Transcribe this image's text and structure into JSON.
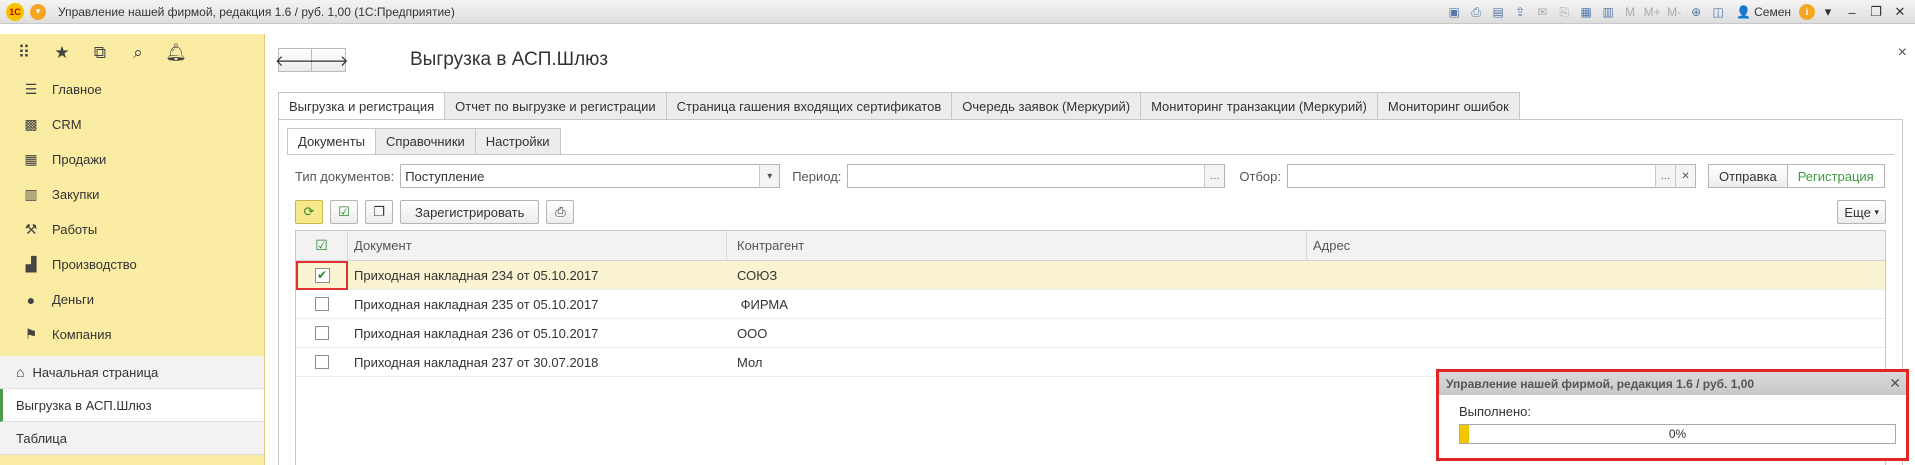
{
  "titlebar": {
    "title": "Управление нашей фирмой, редакция 1.6 / руб. 1,00  (1С:Предприятие)",
    "user": "Семен",
    "logo": "1С"
  },
  "sidebar": {
    "items": [
      {
        "label": "Главное",
        "icon": "list-icon"
      },
      {
        "label": "CRM",
        "icon": "contacts-icon"
      },
      {
        "label": "Продажи",
        "icon": "sales-icon"
      },
      {
        "label": "Закупки",
        "icon": "cart-icon"
      },
      {
        "label": "Работы",
        "icon": "tools-icon"
      },
      {
        "label": "Производство",
        "icon": "factory-icon"
      },
      {
        "label": "Деньги",
        "icon": "money-icon"
      },
      {
        "label": "Компания",
        "icon": "flag-icon"
      }
    ],
    "open_windows": [
      {
        "label": "Начальная страница"
      },
      {
        "label": "Выгрузка в АСП.Шлюз"
      },
      {
        "label": "Таблица"
      }
    ]
  },
  "main": {
    "title": "Выгрузка в АСП.Шлюз",
    "tabs": [
      {
        "label": "Выгрузка и регистрация"
      },
      {
        "label": "Отчет по выгрузке и регистрации"
      },
      {
        "label": "Страница гашения входящих сертификатов"
      },
      {
        "label": "Очередь заявок (Меркурий)"
      },
      {
        "label": "Мониторинг транзакции (Меркурий)"
      },
      {
        "label": "Мониторинг ошибок"
      }
    ],
    "subtabs": [
      {
        "label": "Документы"
      },
      {
        "label": "Справочники"
      },
      {
        "label": "Настройки"
      }
    ],
    "filters": {
      "doc_type_label": "Тип документов:",
      "doc_type_value": "Поступление",
      "period_label": "Период:",
      "period_value": "",
      "filter_label": "Отбор:",
      "filter_value": "",
      "mode_send": "Отправка",
      "mode_register": "Регистрация"
    },
    "toolbar": {
      "register_label": "Зарегистрировать",
      "more_label": "Еще"
    },
    "table": {
      "columns": [
        "Документ",
        "Контрагент",
        "Адрес"
      ],
      "rows": [
        {
          "checked": true,
          "document": "Приходная накладная 234 от 05.10.2017",
          "counterparty": "СОЮЗ",
          "address": ""
        },
        {
          "checked": false,
          "document": "Приходная накладная 235 от 05.10.2017",
          "counterparty": " ФИРМА",
          "address": ""
        },
        {
          "checked": false,
          "document": "Приходная накладная 236 от 05.10.2017",
          "counterparty": "ООО",
          "address": ""
        },
        {
          "checked": false,
          "document": "Приходная накладная 237 от 30.07.2018",
          "counterparty": "Мол",
          "address": ""
        }
      ]
    }
  },
  "progress_popup": {
    "title": "Управление нашей фирмой, редакция 1.6 / руб. 1,00",
    "label": "Выполнено:",
    "percent_text": "0%",
    "progress": 0.005
  },
  "colors": {
    "sidebar_bg": "#fbeca3",
    "accent_green": "#3f9a3f",
    "highlight_red": "#e02525",
    "progress_fill": "#f3c600"
  }
}
